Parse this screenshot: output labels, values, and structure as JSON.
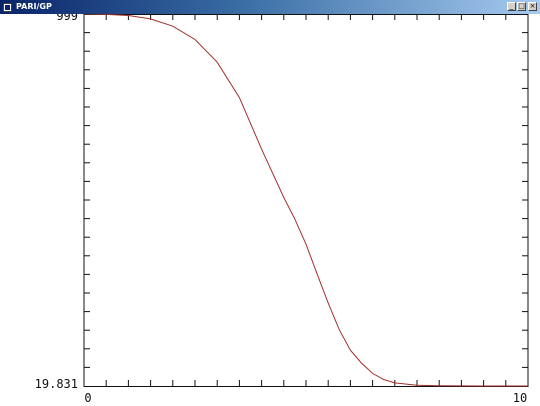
{
  "window": {
    "title": "PARI/GP",
    "buttons": {
      "minimize": "_",
      "maximize": "□",
      "close": "×"
    }
  },
  "chart_data": {
    "type": "line",
    "title": "",
    "xlabel": "",
    "ylabel": "",
    "xlim": [
      0,
      10
    ],
    "ylim": [
      19.831,
      999
    ],
    "x_tick_labels": [
      "0",
      "10"
    ],
    "y_tick_labels": [
      "999",
      "19.831"
    ],
    "grid": false,
    "series": [
      {
        "color": "#a0302a",
        "x": [
          0,
          0.5,
          1,
          1.5,
          2,
          2.5,
          3,
          3.5,
          4,
          4.5,
          4.75,
          5,
          5.25,
          5.5,
          5.75,
          6,
          6.25,
          6.5,
          6.75,
          7,
          7.5,
          8,
          8.5,
          9,
          9.5,
          10
        ],
        "y": [
          999,
          998,
          995,
          986,
          967,
          932,
          872,
          779,
          643,
          516,
          459,
          393,
          315,
          238,
          168,
          114,
          80,
          53,
          37,
          28,
          22,
          20.5,
          20,
          19.9,
          19.85,
          19.831
        ]
      }
    ]
  }
}
